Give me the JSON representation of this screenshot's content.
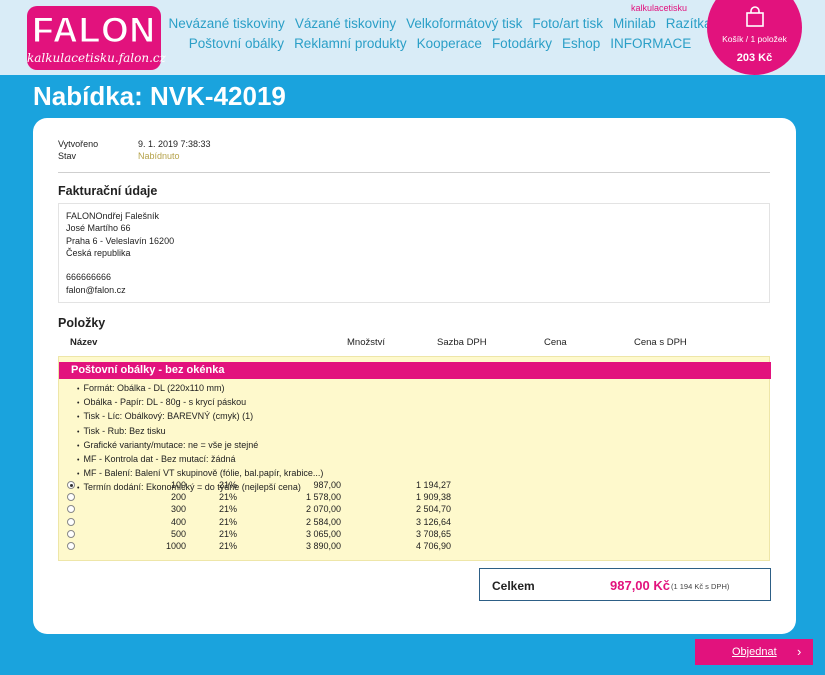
{
  "header": {
    "logo_text": "FALON",
    "logo_url": "kalkulacetisku.falon.cz",
    "site_label": "kalkulacetisku",
    "nav_row1": [
      "Nevázané tiskoviny",
      "Vázané tiskoviny",
      "Velkoformátový tisk",
      "Foto/art tisk",
      "Minilab",
      "Razítka"
    ],
    "nav_row2": [
      "Poštovní obálky",
      "Reklamní produkty",
      "Kooperace",
      "Fotodárky",
      "Eshop",
      "INFORMACE"
    ],
    "cart": {
      "label": "Košík / 1 položek",
      "price": "203 Kč"
    }
  },
  "page_title": "Nabídka: NVK-42019",
  "meta": {
    "created_label": "Vytvořeno",
    "created_value": "9. 1. 2019 7:38:33",
    "state_label": "Stav",
    "state_value": "Nabídnuto"
  },
  "billing": {
    "title": "Fakturační údaje",
    "lines": [
      "FALONOndřej Falešník",
      "José Martího 66",
      "Praha 6 - Veleslavín 16200",
      "Česká republika",
      "",
      "666666666",
      "falon@falon.cz"
    ]
  },
  "items": {
    "title": "Položky",
    "columns": [
      "Název",
      "Množství",
      "Sazba DPH",
      "Cena",
      "Cena s DPH"
    ],
    "product": "Poštovní obálky - bez okénka",
    "specs": [
      "Formát: Obálka - DL (220x110 mm)",
      "Obálka - Papír: DL - 80g - s krycí páskou",
      "Tisk - Líc: Obálkový: BAREVNÝ (cmyk) (1)",
      "Tisk - Rub: Bez tisku",
      "Grafické varianty/mutace: ne = vše je stejné",
      "MF - Kontrola dat - Bez mutací: žádná",
      "MF - Balení: Balení VT skupinově (fólie, bal.papír, krabice...)",
      "Termín dodání: Ekonomický = do týdne (nejlepší cena)"
    ],
    "rows": [
      {
        "qty": "100",
        "vat": "21%",
        "price": "987,00",
        "price_vat": "1 194,27",
        "selected": true
      },
      {
        "qty": "200",
        "vat": "21%",
        "price": "1 578,00",
        "price_vat": "1 909,38",
        "selected": false
      },
      {
        "qty": "300",
        "vat": "21%",
        "price": "2 070,00",
        "price_vat": "2 504,70",
        "selected": false
      },
      {
        "qty": "400",
        "vat": "21%",
        "price": "2 584,00",
        "price_vat": "3 126,64",
        "selected": false
      },
      {
        "qty": "500",
        "vat": "21%",
        "price": "3 065,00",
        "price_vat": "3 708,65",
        "selected": false
      },
      {
        "qty": "1000",
        "vat": "21%",
        "price": "3 890,00",
        "price_vat": "4 706,90",
        "selected": false
      }
    ]
  },
  "total": {
    "label": "Celkem",
    "amount": "987,00 Kč",
    "with_vat": "(1 194 Kč s DPH)"
  },
  "order_button": "Objednat",
  "colors": {
    "brand": "#e2127d",
    "background": "#1aa3dd",
    "header": "#d9ecf7",
    "state": "#b5a24a"
  }
}
